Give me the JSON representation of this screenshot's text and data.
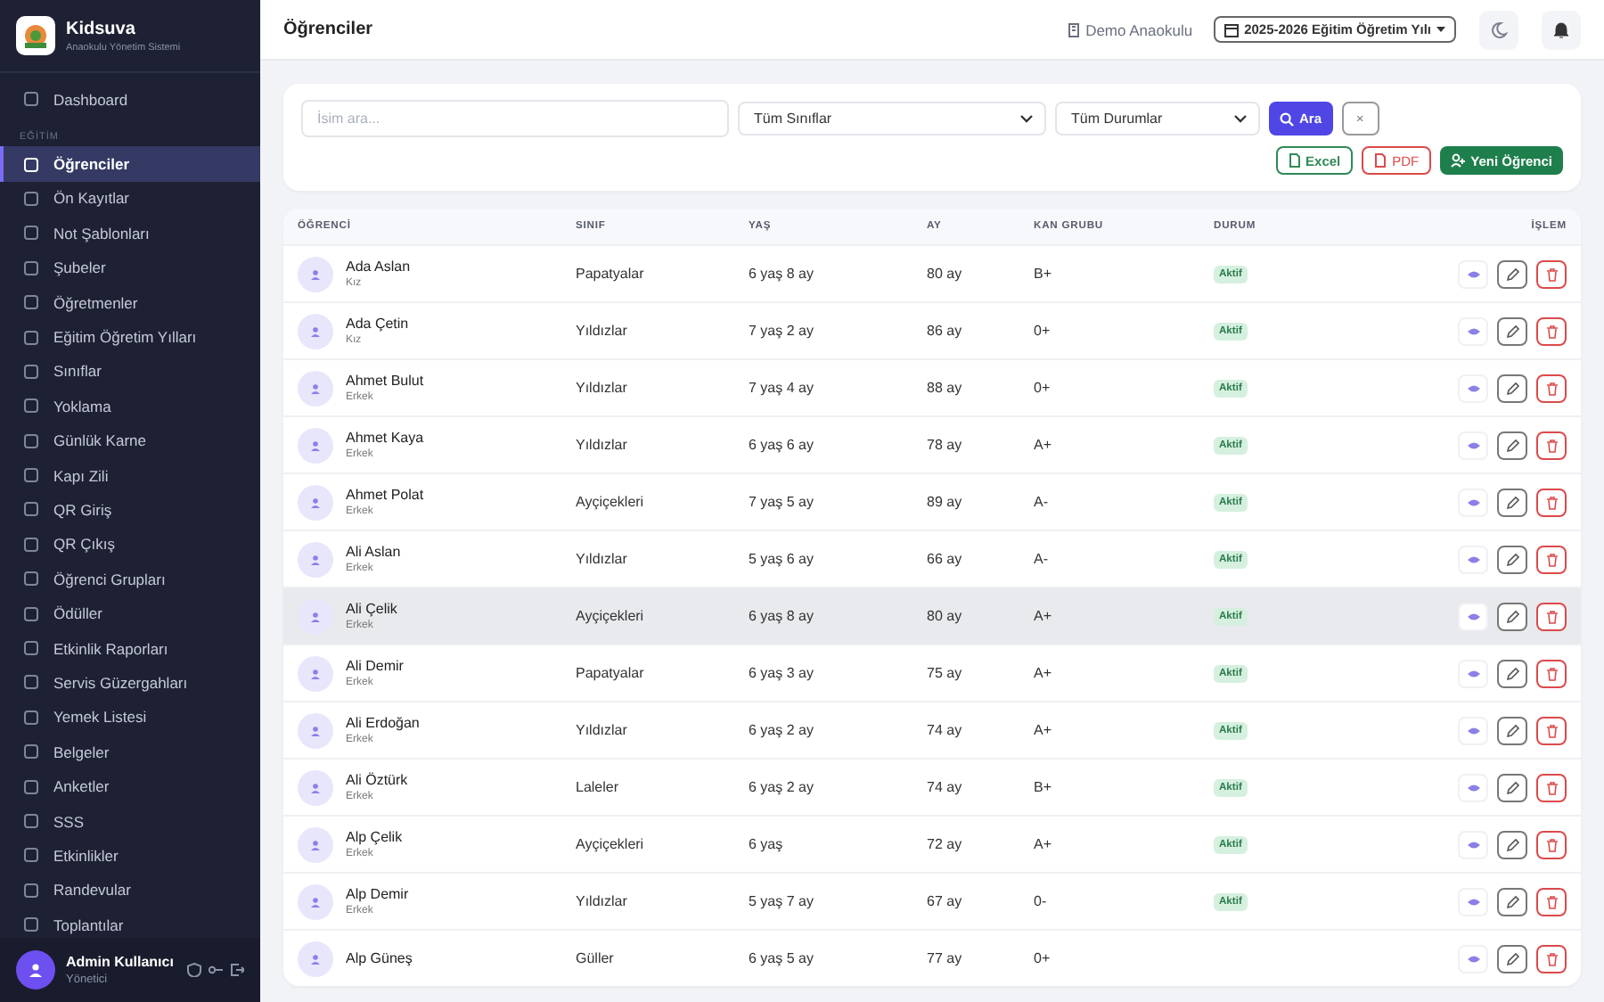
{
  "brand": {
    "name": "Kidsuva",
    "subtitle": "Anaokulu Yönetim Sistemi"
  },
  "sidebar": {
    "items": [
      {
        "kind": "item",
        "label": "Dashboard",
        "selected": false
      },
      {
        "kind": "section",
        "label": "EĞİTİM"
      },
      {
        "kind": "item",
        "label": "Öğrenciler",
        "selected": true
      },
      {
        "kind": "item",
        "label": "Ön Kayıtlar",
        "selected": false
      },
      {
        "kind": "item",
        "label": "Not Şablonları",
        "selected": false
      },
      {
        "kind": "item",
        "label": "Şubeler",
        "selected": false
      },
      {
        "kind": "item",
        "label": "Öğretmenler",
        "selected": false
      },
      {
        "kind": "item",
        "label": "Eğitim Öğretim Yılları",
        "selected": false
      },
      {
        "kind": "item",
        "label": "Sınıflar",
        "selected": false
      },
      {
        "kind": "item",
        "label": "Yoklama",
        "selected": false
      },
      {
        "kind": "item",
        "label": "Günlük Karne",
        "selected": false
      },
      {
        "kind": "item",
        "label": "Kapı Zili",
        "selected": false
      },
      {
        "kind": "item",
        "label": "QR Giriş",
        "selected": false
      },
      {
        "kind": "item",
        "label": "QR Çıkış",
        "selected": false
      },
      {
        "kind": "item",
        "label": "Öğrenci Grupları",
        "selected": false
      },
      {
        "kind": "item",
        "label": "Ödüller",
        "selected": false
      },
      {
        "kind": "item",
        "label": "Etkinlik Raporları",
        "selected": false
      },
      {
        "kind": "item",
        "label": "Servis Güzergahları",
        "selected": false
      },
      {
        "kind": "item",
        "label": "Yemek Listesi",
        "selected": false
      },
      {
        "kind": "item",
        "label": "Belgeler",
        "selected": false
      },
      {
        "kind": "item",
        "label": "Anketler",
        "selected": false
      },
      {
        "kind": "item",
        "label": "SSS",
        "selected": false
      },
      {
        "kind": "item",
        "label": "Etkinlikler",
        "selected": false
      },
      {
        "kind": "item",
        "label": "Randevular",
        "selected": false
      },
      {
        "kind": "item",
        "label": "Toplantılar",
        "selected": false
      }
    ],
    "user": {
      "name": "Admin Kullanıcı",
      "role": "Yönetici"
    }
  },
  "header": {
    "title": "Öğrenciler",
    "school": "Demo Anaokulu",
    "year": "2025-2026 Eğitim Öğretim Yılı"
  },
  "filters": {
    "search": {
      "placeholder": "İsim ara..."
    },
    "class_select": "Tüm Sınıflar",
    "status_select": "Tüm Durumlar",
    "search_button": "Ara",
    "clear_button": "×",
    "export_buttons": [
      {
        "kind": "excel",
        "label": "Excel"
      },
      {
        "kind": "pdf",
        "label": "PDF"
      }
    ],
    "new_button": "Yeni Öğrenci"
  },
  "table": {
    "columns": [
      "ÖĞRENCİ",
      "SINIF",
      "YAŞ",
      "AY",
      "KAN GRUBU",
      "DURUM",
      "İŞLEM"
    ],
    "rows": [
      {
        "name": "Ada Aslan",
        "gender": "Kız",
        "class": "Papatyalar",
        "age": "6 yaş 8 ay",
        "months": "80 ay",
        "blood": "B+",
        "status": "Aktif",
        "selected": false
      },
      {
        "name": "Ada Çetin",
        "gender": "Kız",
        "class": "Yıldızlar",
        "age": "7 yaş 2 ay",
        "months": "86 ay",
        "blood": "0+",
        "status": "Aktif",
        "selected": false
      },
      {
        "name": "Ahmet Bulut",
        "gender": "Erkek",
        "class": "Yıldızlar",
        "age": "7 yaş 4 ay",
        "months": "88 ay",
        "blood": "0+",
        "status": "Aktif",
        "selected": false
      },
      {
        "name": "Ahmet Kaya",
        "gender": "Erkek",
        "class": "Yıldızlar",
        "age": "6 yaş 6 ay",
        "months": "78 ay",
        "blood": "A+",
        "status": "Aktif",
        "selected": false
      },
      {
        "name": "Ahmet Polat",
        "gender": "Erkek",
        "class": "Ayçiçekleri",
        "age": "7 yaş 5 ay",
        "months": "89 ay",
        "blood": "A-",
        "status": "Aktif",
        "selected": false
      },
      {
        "name": "Ali Aslan",
        "gender": "Erkek",
        "class": "Yıldızlar",
        "age": "5 yaş 6 ay",
        "months": "66 ay",
        "blood": "A-",
        "status": "Aktif",
        "selected": false
      },
      {
        "name": "Ali Çelik",
        "gender": "Erkek",
        "class": "Ayçiçekleri",
        "age": "6 yaş 8 ay",
        "months": "80 ay",
        "blood": "A+",
        "status": "Aktif",
        "selected": true
      },
      {
        "name": "Ali Demir",
        "gender": "Erkek",
        "class": "Papatyalar",
        "age": "6 yaş 3 ay",
        "months": "75 ay",
        "blood": "A+",
        "status": "Aktif",
        "selected": false
      },
      {
        "name": "Ali Erdoğan",
        "gender": "Erkek",
        "class": "Yıldızlar",
        "age": "6 yaş 2 ay",
        "months": "74 ay",
        "blood": "A+",
        "status": "Aktif",
        "selected": false
      },
      {
        "name": "Ali Öztürk",
        "gender": "Erkek",
        "class": "Laleler",
        "age": "6 yaş 2 ay",
        "months": "74 ay",
        "blood": "B+",
        "status": "Aktif",
        "selected": false
      },
      {
        "name": "Alp Çelik",
        "gender": "Erkek",
        "class": "Ayçiçekleri",
        "age": "6 yaş",
        "months": "72 ay",
        "blood": "A+",
        "status": "Aktif",
        "selected": false
      },
      {
        "name": "Alp Demir",
        "gender": "Erkek",
        "class": "Yıldızlar",
        "age": "5 yaş 7 ay",
        "months": "67 ay",
        "blood": "0-",
        "status": "Aktif",
        "selected": false
      },
      {
        "name": "Alp Güneş",
        "class": "Güller",
        "age": "6 yaş 5 ay",
        "months": "77 ay",
        "blood": "0+",
        "selected": false
      }
    ]
  }
}
